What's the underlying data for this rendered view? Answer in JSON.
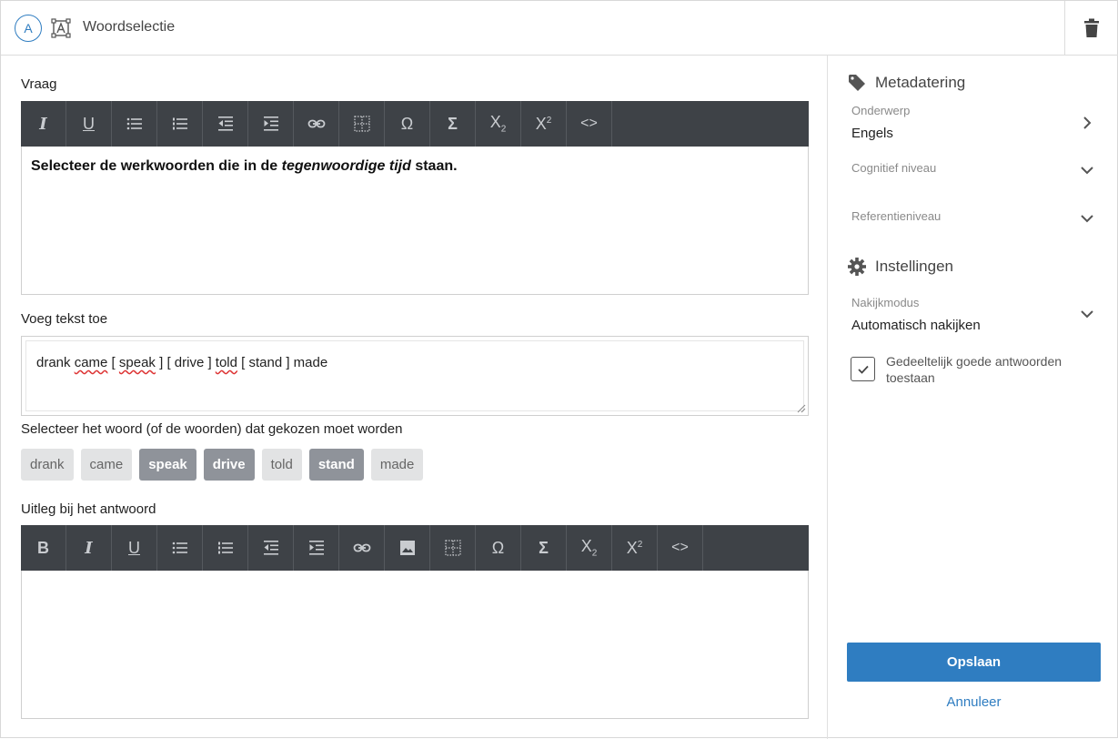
{
  "header": {
    "badge": "A",
    "title": "Woordselectie",
    "type_icon": "text-select-icon",
    "delete_icon": "trash-icon"
  },
  "question": {
    "label": "Vraag",
    "text_part1": "Selecteer de werkwoorden die in de ",
    "text_italic": "tegenwoordige tijd",
    "text_part2": " staan.",
    "toolbar": [
      "italic-icon",
      "underline-icon",
      "bullet-list-icon",
      "numbered-list-icon",
      "outdent-icon",
      "indent-icon",
      "link-icon",
      "table-icon",
      "omega-icon",
      "sigma-icon",
      "subscript-icon",
      "superscript-icon",
      "code-icon"
    ]
  },
  "add_text": {
    "label": "Voeg tekst toe",
    "tokens": [
      {
        "text": "drank",
        "spell": false
      },
      {
        "text": " "
      },
      {
        "text": "came",
        "spell": true
      },
      {
        "text": " [ "
      },
      {
        "text": "speak",
        "spell": true
      },
      {
        "text": " ] [ drive ] "
      },
      {
        "text": "told",
        "spell": true
      },
      {
        "text": " [ stand ] made"
      }
    ]
  },
  "selection": {
    "label": "Selecteer het woord (of de woorden) dat gekozen moet worden",
    "words": [
      {
        "text": "drank",
        "selected": false
      },
      {
        "text": "came",
        "selected": false
      },
      {
        "text": "speak",
        "selected": true
      },
      {
        "text": "drive",
        "selected": true
      },
      {
        "text": "told",
        "selected": false
      },
      {
        "text": "stand",
        "selected": true
      },
      {
        "text": "made",
        "selected": false
      }
    ]
  },
  "explanation": {
    "label": "Uitleg bij het antwoord",
    "toolbar": [
      "bold-icon",
      "italic-icon",
      "underline-icon",
      "bullet-list-icon",
      "numbered-list-icon",
      "outdent-icon",
      "indent-icon",
      "link-icon",
      "image-icon",
      "table-icon",
      "omega-icon",
      "sigma-icon",
      "subscript-icon",
      "superscript-icon",
      "code-icon"
    ]
  },
  "sidebar": {
    "metadata_title": "Metadatering",
    "subject_label": "Onderwerp",
    "subject_value": "Engels",
    "cognitive_label": "Cognitief niveau",
    "reference_label": "Referentieniveau",
    "settings_title": "Instellingen",
    "mode_label": "Nakijkmodus",
    "mode_value": "Automatisch nakijken",
    "partial_label": "Gedeeltelijk goede antwoorden toestaan",
    "partial_checked": true,
    "save_label": "Opslaan",
    "cancel_label": "Annuleer"
  },
  "colors": {
    "accent": "#2f7dc1",
    "toolbar": "#3e4247",
    "chip_selected": "#8f939a",
    "chip": "#e2e3e4"
  }
}
